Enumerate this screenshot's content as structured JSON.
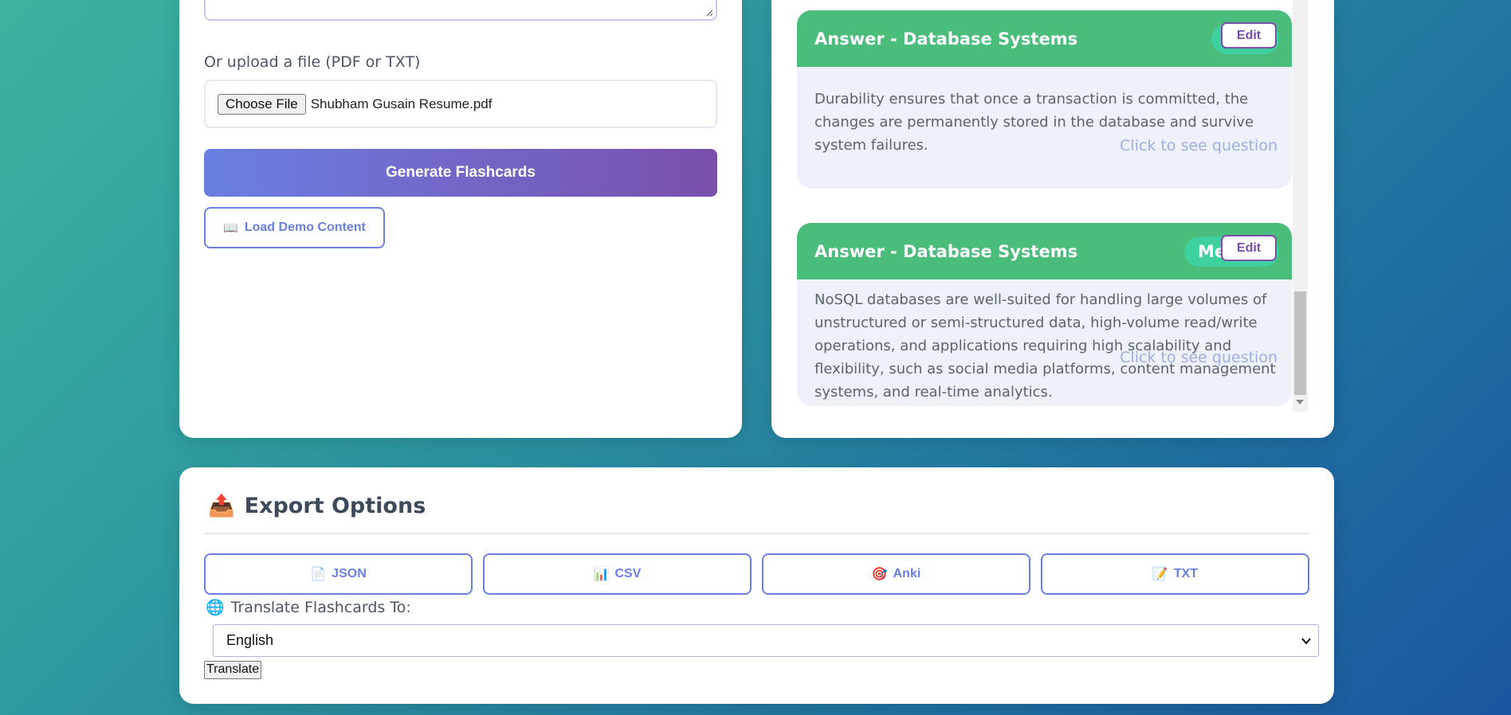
{
  "upload": {
    "label": "Or upload a file (PDF or TXT)",
    "choose_button": "Choose File",
    "file_name": "Shubham Gusain Resume.pdf"
  },
  "actions": {
    "generate_label": "Generate Flashcards",
    "demo_icon": "📖",
    "demo_label": "Load Demo Content"
  },
  "flashcards": [
    {
      "header": "Answer - Database Systems",
      "difficulty": "",
      "edit_label": "Edit",
      "body": "Durability ensures that once a transaction is committed, the changes are permanently stored in the database and survive system failures.",
      "flip_hint": "Click to see question"
    },
    {
      "header": "Answer - Database Systems",
      "difficulty": "Me",
      "edit_label": "Edit",
      "body": "NoSQL databases are well-suited for handling large volumes of unstructured or semi-structured data, high-volume read/write operations, and applications requiring high scalability and flexibility, such as social media platforms, content management systems, and real-time analytics.",
      "flip_hint": "Click to see question"
    }
  ],
  "export": {
    "title_icon": "📤",
    "title": "Export Options",
    "buttons": [
      {
        "icon": "📄",
        "label": "JSON"
      },
      {
        "icon": "📊",
        "label": "CSV"
      },
      {
        "icon": "🎯",
        "label": "Anki"
      },
      {
        "icon": "📝",
        "label": "TXT"
      }
    ]
  },
  "translate": {
    "icon": "🌐",
    "label": "Translate Flashcards To:",
    "selected_language": "English",
    "button_label": "Translate"
  },
  "colors": {
    "accent": "#6a7fe3",
    "card_header": "#4bbd7b",
    "difficulty_pill": "#3fd0a0",
    "edit_border": "#7a4fab"
  }
}
